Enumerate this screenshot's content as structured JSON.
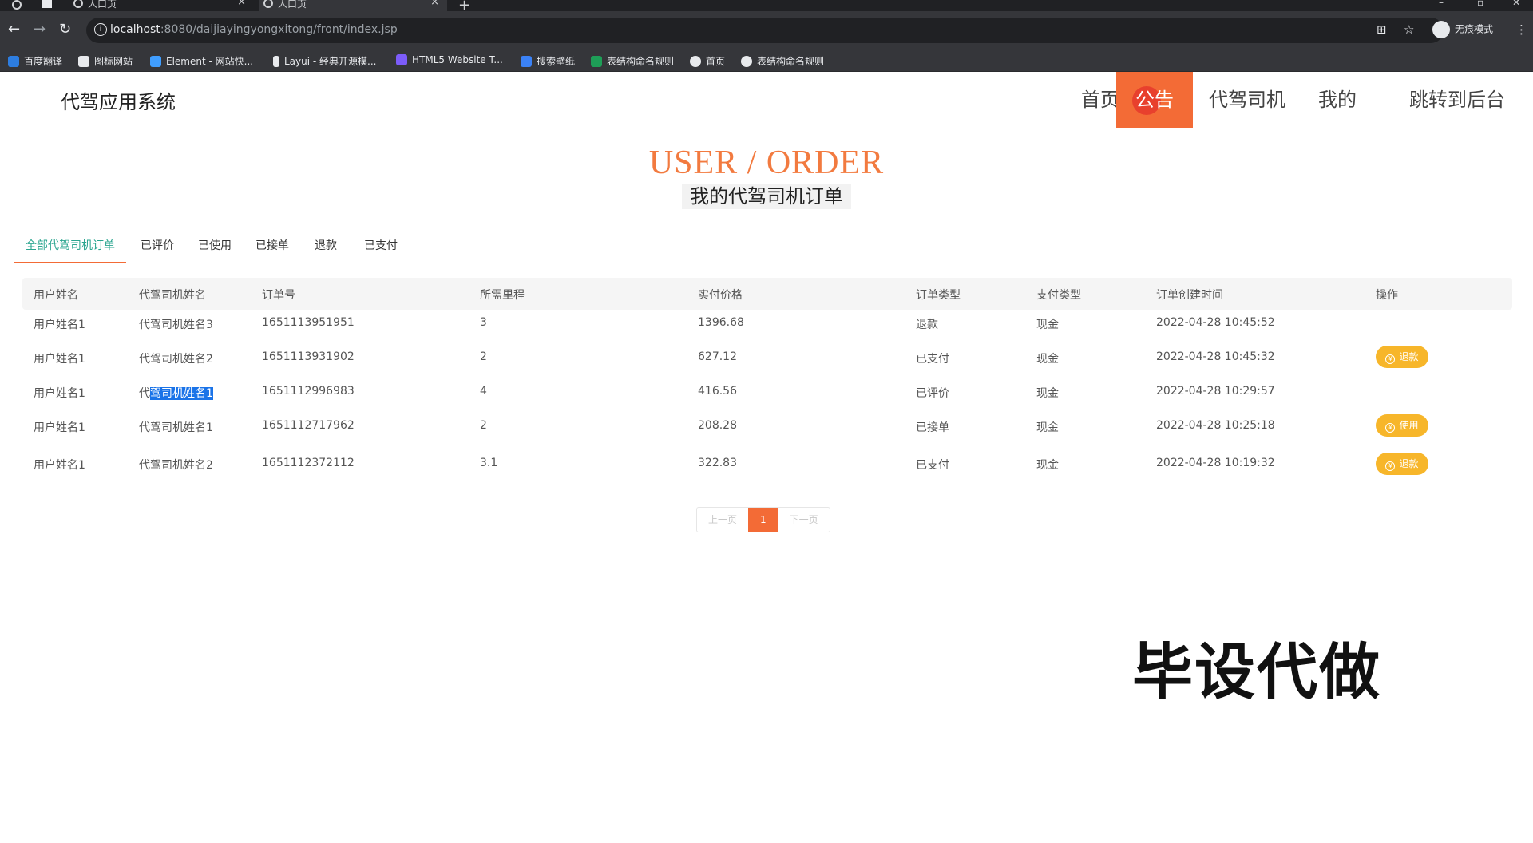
{
  "browser": {
    "tabs": [
      {
        "title": "人口页",
        "active": false
      },
      {
        "title": "人口页",
        "active": true
      }
    ],
    "url_host": "localhost",
    "url_rest": ":8080/daijiayingyongxitong/front/index.jsp",
    "incognito_label": "无痕模式",
    "bookmarks": [
      {
        "label": "百度翻译",
        "color": "#2d7de0"
      },
      {
        "label": "图标网站",
        "color": "#e8eaed"
      },
      {
        "label": "Element - 网站快...",
        "color": "#409eff"
      },
      {
        "label": "Layui - 经典开源模...",
        "color": "#e8eaed"
      },
      {
        "label": "HTML5 Website T...",
        "color": "#7c5cfa"
      },
      {
        "label": "搜索壁纸",
        "color": "#3b82f6"
      },
      {
        "label": "表结构命名规则",
        "color": "#1e9e57"
      },
      {
        "label": "首页",
        "color": "#e8eaed"
      },
      {
        "label": "表结构命名规则",
        "color": "#e8eaed"
      }
    ]
  },
  "header": {
    "logo": "代驾应用系统",
    "nav": [
      {
        "label": "首页",
        "active": false
      },
      {
        "label": "公告",
        "active": true
      },
      {
        "label": "代驾司机",
        "active": false
      },
      {
        "label": "我的",
        "active": false
      },
      {
        "label": "跳转到后台",
        "active": false
      }
    ]
  },
  "banner": {
    "en": "USER / ORDER",
    "cn": "我的代驾司机订单"
  },
  "tabs": [
    {
      "label": "全部代驾司机订单",
      "active": true
    },
    {
      "label": "已评价",
      "active": false
    },
    {
      "label": "已使用",
      "active": false
    },
    {
      "label": "已接单",
      "active": false
    },
    {
      "label": "退款",
      "active": false
    },
    {
      "label": "已支付",
      "active": false
    }
  ],
  "table": {
    "headers": [
      "用户姓名",
      "代驾司机姓名",
      "订单号",
      "所需里程",
      "实付价格",
      "订单类型",
      "支付类型",
      "订单创建时间",
      "操作"
    ],
    "rows": [
      {
        "user": "用户姓名1",
        "driver": "代驾司机姓名3",
        "order_no": "1651113951951",
        "mileage": "3",
        "price": "1396.68",
        "type": "退款",
        "pay": "现金",
        "time": "2022-04-28 10:45:52",
        "action": ""
      },
      {
        "user": "用户姓名1",
        "driver": "代驾司机姓名2",
        "order_no": "1651113931902",
        "mileage": "2",
        "price": "627.12",
        "type": "已支付",
        "pay": "现金",
        "time": "2022-04-28 10:45:32",
        "action": "退款"
      },
      {
        "user": "用户姓名1",
        "driver_prefix": "代",
        "driver_selected": "驾司机姓名1",
        "order_no": "1651112996983",
        "mileage": "4",
        "price": "416.56",
        "type": "已评价",
        "pay": "现金",
        "time": "2022-04-28 10:29:57",
        "action": ""
      },
      {
        "user": "用户姓名1",
        "driver": "代驾司机姓名1",
        "order_no": "1651112717962",
        "mileage": "2",
        "price": "208.28",
        "type": "已接单",
        "pay": "现金",
        "time": "2022-04-28 10:25:18",
        "action": "使用"
      },
      {
        "user": "用户姓名1",
        "driver": "代驾司机姓名2",
        "order_no": "1651112372112",
        "mileage": "3.1",
        "price": "322.83",
        "type": "已支付",
        "pay": "现金",
        "time": "2022-04-28 10:19:32",
        "action": "退款"
      }
    ]
  },
  "pager": {
    "prev": "上一页",
    "current": "1",
    "next": "下一页"
  },
  "watermark": "毕设代做",
  "colors": {
    "accent": "#f36b36",
    "tab_active_text": "#2aa58f",
    "action_button": "#f7b62a"
  }
}
